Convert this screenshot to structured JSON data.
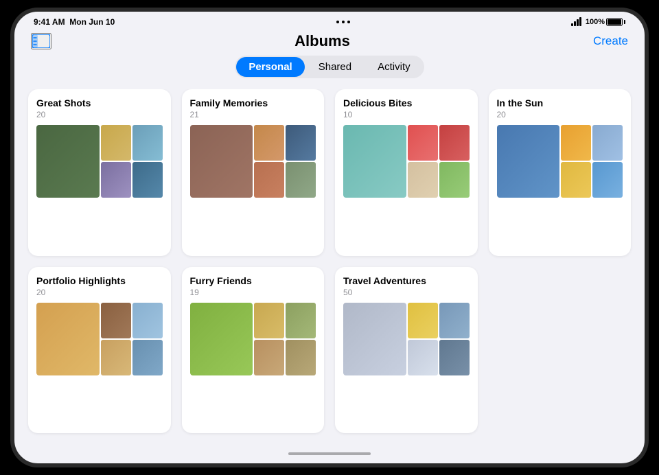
{
  "device": {
    "status_bar": {
      "time": "9:41 AM",
      "date": "Mon Jun 10",
      "battery_pct": "100%",
      "dots": [
        "•",
        "•",
        "•"
      ]
    },
    "nav": {
      "title": "Albums",
      "create_label": "Create"
    },
    "segments": [
      {
        "id": "personal",
        "label": "Personal",
        "active": true
      },
      {
        "id": "shared",
        "label": "Shared",
        "active": false
      },
      {
        "id": "activity",
        "label": "Activity",
        "active": false
      }
    ],
    "albums": [
      {
        "id": "great-shots",
        "title": "Great Shots",
        "count": "20"
      },
      {
        "id": "family-memories",
        "title": "Family Memories",
        "count": "21"
      },
      {
        "id": "delicious-bites",
        "title": "Delicious Bites",
        "count": "10"
      },
      {
        "id": "in-the-sun",
        "title": "In the Sun",
        "count": "20"
      },
      {
        "id": "portfolio-highlights",
        "title": "Portfolio Highlights",
        "count": "20"
      },
      {
        "id": "furry-friends",
        "title": "Furry Friends",
        "count": "19"
      },
      {
        "id": "travel-adventures",
        "title": "Travel Adventures",
        "count": "50"
      }
    ]
  }
}
